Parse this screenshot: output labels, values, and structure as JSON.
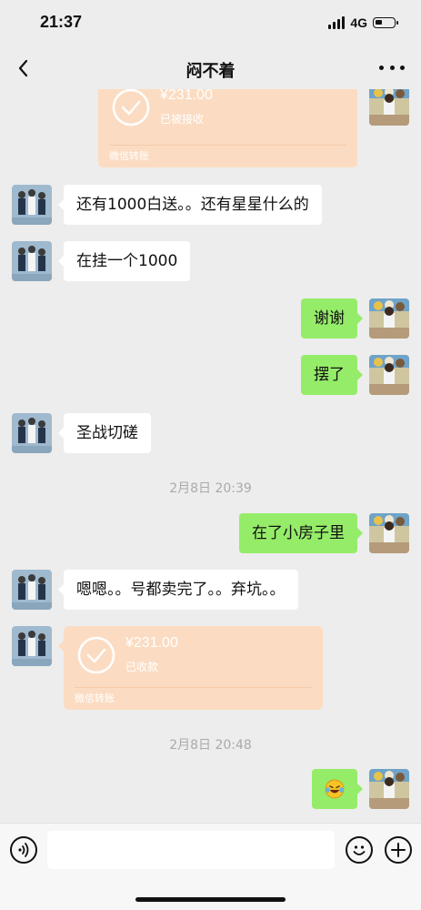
{
  "status_bar": {
    "time": "21:37",
    "network": "4G",
    "battery_level": 0.35
  },
  "header": {
    "title": "闷不着"
  },
  "messages": {
    "m0_amount": "¥231.00",
    "m0_status": "已被接收",
    "m0_footer": "微信转账",
    "m1": "还有1000白送。。还有星星什么的",
    "m2": "在挂一个1000",
    "m3": "谢谢",
    "m4": "摆了",
    "m5": "圣战切磋",
    "t1": "2月8日 20:39",
    "m6": "在了小房子里",
    "m7": "嗯嗯。。号都卖完了。。弃坑。。",
    "m8_amount": "¥231.00",
    "m8_status": "已收款",
    "m8_footer": "微信转账",
    "t2": "2月8日 20:48",
    "m9_emoji": "laughing-tears-emoji"
  },
  "input_bar": {
    "placeholder": ""
  },
  "icons": {
    "back": "chevron-left-icon",
    "more": "more-dots-icon",
    "voice": "voice-icon",
    "emoji": "emoji-icon",
    "plus": "plus-icon"
  },
  "colors": {
    "background": "#ededed",
    "my_bubble": "#95ec69",
    "their_bubble": "#ffffff",
    "transfer_card": "#fbdcc2",
    "timestamp": "#aaaaaa"
  }
}
